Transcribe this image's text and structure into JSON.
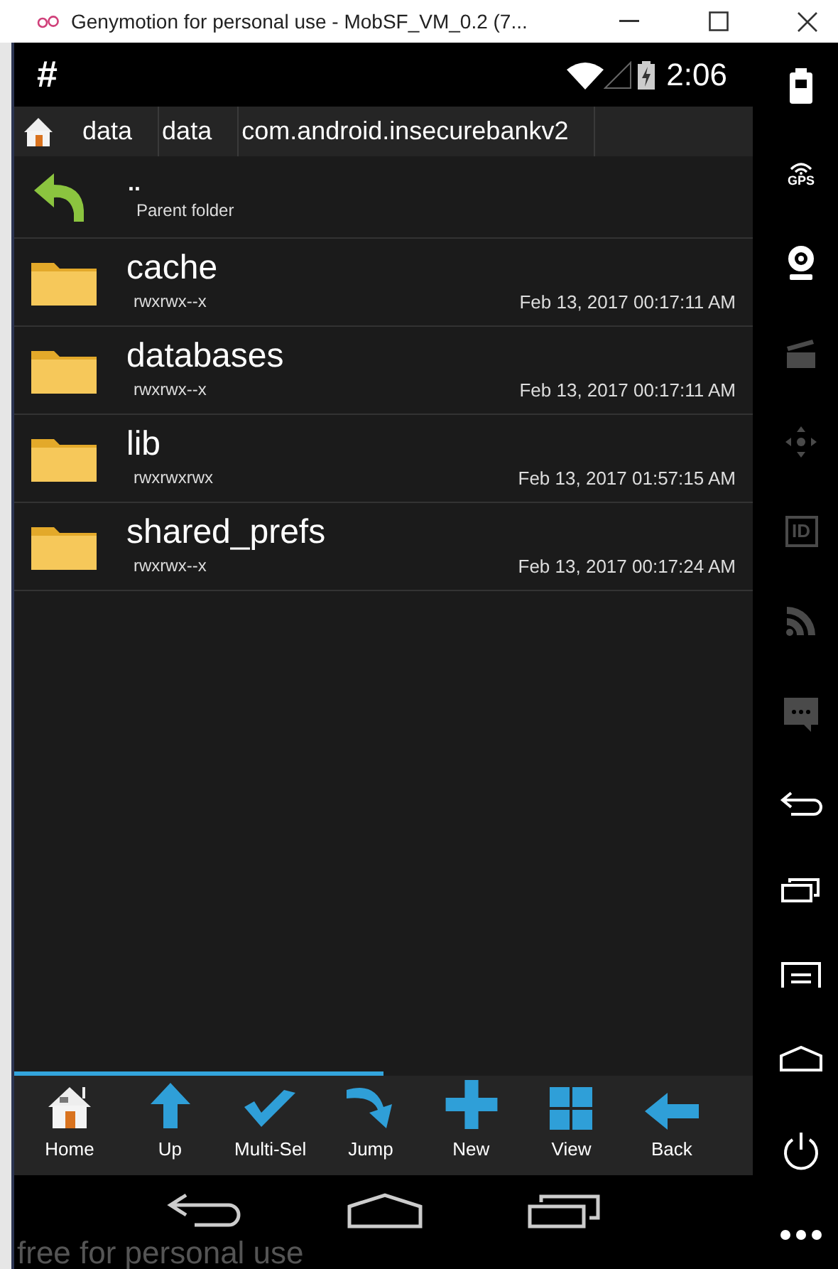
{
  "window": {
    "title": "Genymotion for personal use - MobSF_VM_0.2 (7..."
  },
  "status_bar": {
    "notification": "#",
    "time": "2:06"
  },
  "breadcrumbs": [
    "data",
    "data",
    "com.android.insecurebankv2"
  ],
  "parent": {
    "name": "..",
    "label": "Parent folder"
  },
  "files": [
    {
      "name": "cache",
      "permissions": "rwxrwx--x",
      "modified": "Feb 13, 2017 00:17:11 AM"
    },
    {
      "name": "databases",
      "permissions": "rwxrwx--x",
      "modified": "Feb 13, 2017 00:17:11 AM"
    },
    {
      "name": "lib",
      "permissions": "rwxrwxrwx",
      "modified": "Feb 13, 2017 01:57:15 AM"
    },
    {
      "name": "shared_prefs",
      "permissions": "rwxrwx--x",
      "modified": "Feb 13, 2017 00:17:24 AM"
    }
  ],
  "progress": {
    "level": 0.5
  },
  "toolbar": [
    {
      "kind": "home",
      "label": "Home"
    },
    {
      "kind": "up",
      "label": "Up"
    },
    {
      "kind": "multi",
      "label": "Multi-Sel"
    },
    {
      "kind": "jump",
      "label": "Jump"
    },
    {
      "kind": "new",
      "label": "New"
    },
    {
      "kind": "view",
      "label": "View"
    },
    {
      "kind": "back",
      "label": "Back"
    }
  ],
  "overlay_text": "free for personal use",
  "sidebar": [
    {
      "kind": "battery",
      "disabled": false
    },
    {
      "kind": "gps",
      "label": "GPS",
      "disabled": false
    },
    {
      "kind": "webcam",
      "disabled": false
    },
    {
      "kind": "clapper",
      "disabled": true
    },
    {
      "kind": "dpad",
      "disabled": true
    },
    {
      "kind": "id",
      "label": "ID",
      "disabled": true
    },
    {
      "kind": "signal",
      "disabled": true
    },
    {
      "kind": "sms",
      "disabled": true
    },
    {
      "kind": "back",
      "disabled": false
    },
    {
      "kind": "recent",
      "disabled": false
    },
    {
      "kind": "menu",
      "disabled": false
    },
    {
      "kind": "home",
      "disabled": false
    },
    {
      "kind": "power",
      "disabled": false
    },
    {
      "kind": "more",
      "disabled": false
    }
  ]
}
